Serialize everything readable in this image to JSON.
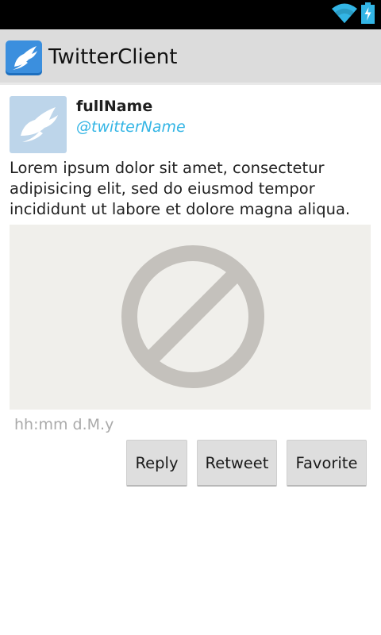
{
  "app": {
    "title": "TwitterClient",
    "icon": "bird-logo-icon"
  },
  "status_bar": {
    "icons": [
      "wifi-icon",
      "battery-charging-icon"
    ],
    "accent_color": "#33b5e5"
  },
  "tweet": {
    "full_name": "fullName",
    "twitter_name": "@twitterName",
    "body": "Lorem ipsum dolor sit amet, consectetur adipisicing elit, sed do eiusmod tempor incididunt ut labore et dolore magna aliqua.",
    "media_placeholder_icon": "no-image-icon",
    "timestamp": "hh:mm d.M.y"
  },
  "actions": {
    "reply_label": "Reply",
    "retweet_label": "Retweet",
    "favorite_label": "Favorite"
  }
}
